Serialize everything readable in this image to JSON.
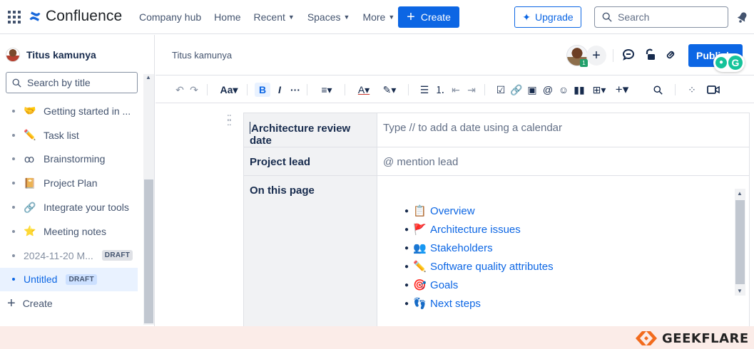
{
  "app": {
    "name": "Confluence",
    "brand_color": "#0c66e4"
  },
  "topnav": {
    "items": [
      {
        "label": "Company hub",
        "dropdown": false
      },
      {
        "label": "Home",
        "dropdown": false
      },
      {
        "label": "Recent",
        "dropdown": true
      },
      {
        "label": "Spaces",
        "dropdown": true
      },
      {
        "label": "More",
        "dropdown": true
      }
    ],
    "create_label": "Create",
    "upgrade_label": "Upgrade",
    "search_placeholder": "Search"
  },
  "sidebar": {
    "space_name": "Titus kamunya",
    "search_placeholder": "Search by title",
    "items": [
      {
        "label": "Getting started in ...",
        "icon": "handshake-icon",
        "glyph": "🤝",
        "draft": false,
        "active": false
      },
      {
        "label": "Task list",
        "icon": "pencil-icon",
        "glyph": "✏️",
        "draft": false,
        "active": false
      },
      {
        "label": "Brainstorming",
        "icon": "brainstorm-icon",
        "glyph": "ꝏ",
        "draft": false,
        "active": false
      },
      {
        "label": "Project Plan",
        "icon": "notebook-icon",
        "glyph": "📔",
        "draft": false,
        "active": false
      },
      {
        "label": "Integrate your tools",
        "icon": "link-icon",
        "glyph": "🔗",
        "draft": false,
        "active": false
      },
      {
        "label": "Meeting notes",
        "icon": "star-icon",
        "glyph": "⭐",
        "draft": false,
        "active": false
      },
      {
        "label": "2024-11-20 M...",
        "icon": "",
        "glyph": "",
        "draft": true,
        "active": false
      },
      {
        "label": "Untitled",
        "icon": "",
        "glyph": "",
        "draft": true,
        "active": true
      }
    ],
    "draft_label": "DRAFT",
    "create_label": "Create"
  },
  "editor": {
    "breadcrumb": "Titus kamunya",
    "publish_label": "Publish",
    "collaborator_badge": "1"
  },
  "page": {
    "rows": [
      {
        "key": "Architecture review date",
        "value": "Type // to add a date using a calendar"
      },
      {
        "key": "Project lead",
        "value": "@ mention lead"
      },
      {
        "key": "On this page",
        "value": ""
      }
    ],
    "toc": [
      {
        "label": "Overview",
        "icon": "clipboard-icon",
        "glyph": "📋"
      },
      {
        "label": "Architecture issues",
        "icon": "red-flag-icon",
        "glyph": "🚩"
      },
      {
        "label": "Stakeholders",
        "icon": "people-icon",
        "glyph": "👥"
      },
      {
        "label": "Software quality attributes",
        "icon": "pencil-icon",
        "glyph": "✏️"
      },
      {
        "label": "Goals",
        "icon": "target-icon",
        "glyph": "🎯"
      },
      {
        "label": "Next steps",
        "icon": "footprints-icon",
        "glyph": "👣"
      }
    ]
  },
  "watermark": {
    "text": "GEEKFLARE",
    "color": "#f26b1d"
  }
}
